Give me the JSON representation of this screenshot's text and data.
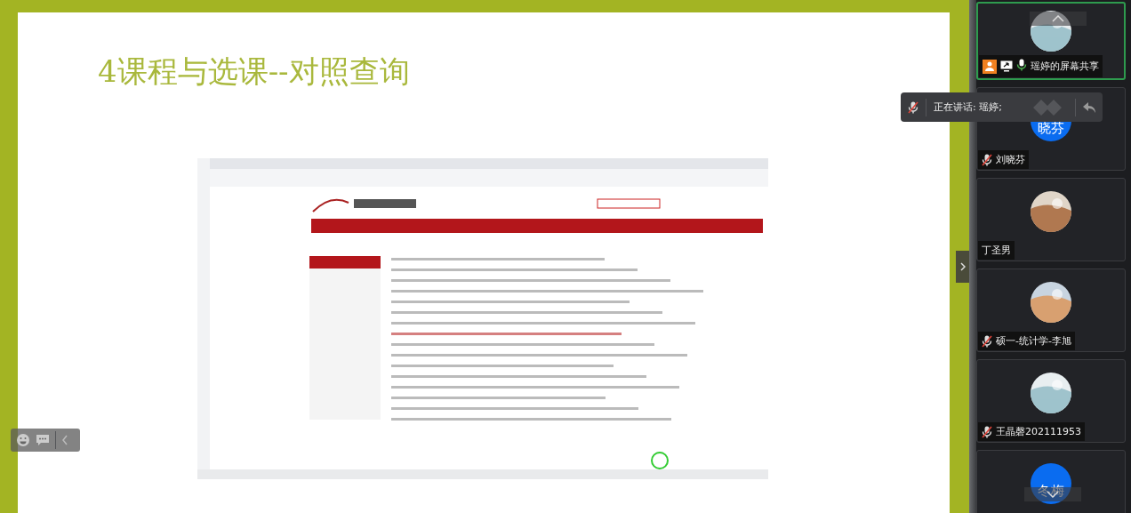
{
  "slide": {
    "title": "4课程与选课--对照查询"
  },
  "participants": [
    {
      "name": "瑶婷的屏幕共享",
      "kind": "screen_share",
      "muted": false,
      "highlighted": true
    },
    {
      "name": "刘晓芬",
      "kind": "person",
      "muted": true,
      "highlighted": false,
      "avatar": {
        "kind": "initials",
        "text": "晓芬"
      }
    },
    {
      "name": "丁圣男",
      "kind": "person",
      "highlighted": false
    },
    {
      "name": "硕一-统计学-李旭",
      "kind": "person",
      "muted": true,
      "highlighted": false
    },
    {
      "name": "王晶磬202111953",
      "kind": "person",
      "muted": true,
      "highlighted": false
    },
    {
      "highlighted": false,
      "avatar": {
        "kind": "initials",
        "text": "冬梅"
      }
    }
  ],
  "speaking_toast": {
    "text": "正在讲话: 瑶婷;"
  }
}
